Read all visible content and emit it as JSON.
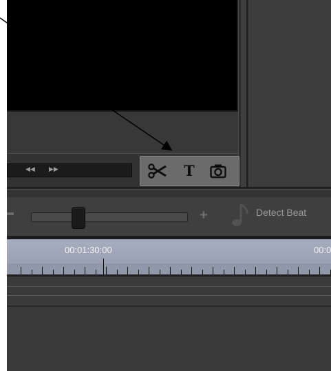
{
  "scrubber": {
    "rewind_label": "◀◀",
    "forward_label": "▶▶"
  },
  "tools": {
    "split_icon": "scissors-icon",
    "title_label": "T",
    "snapshot_icon": "camera-icon"
  },
  "zoom": {
    "minus_label": "–",
    "plus_label": "+",
    "level": 0.3
  },
  "detect_beat": {
    "label": "Detect Beat"
  },
  "ruler": {
    "timecodes": [
      "00:01:30:00",
      "00:0"
    ]
  },
  "colors": {
    "ruler_bg": "#a4abbd",
    "panel_bg": "#3a3a3a",
    "tool_group_bg": "#6b6b6b"
  }
}
